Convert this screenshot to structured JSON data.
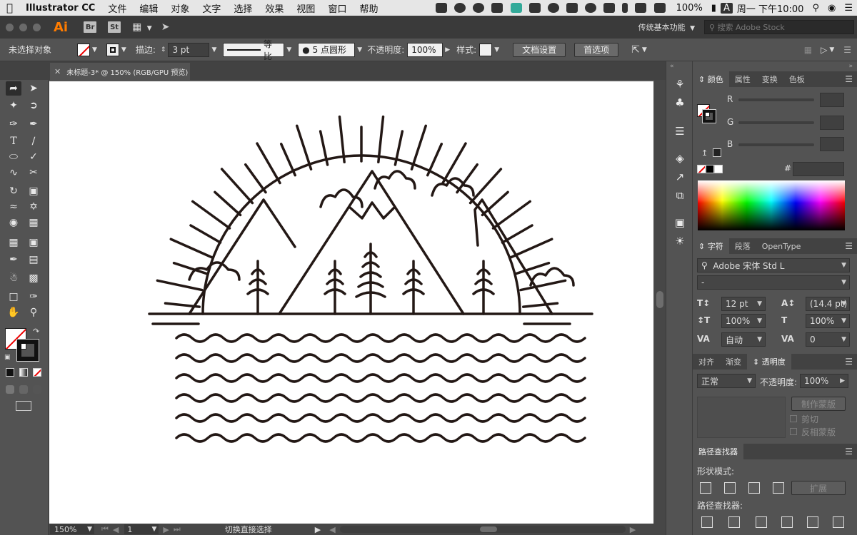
{
  "menubar": {
    "app": "Illustrator CC",
    "items": [
      "文件",
      "编辑",
      "对象",
      "文字",
      "选择",
      "效果",
      "视图",
      "窗口",
      "帮助"
    ],
    "battery": "100%",
    "ime": "A",
    "clock": "周一 下午10:00"
  },
  "appbar": {
    "logo": "Ai",
    "bridge": "Br",
    "stock": "St",
    "workspace": "传统基本功能",
    "search_placeholder": "搜索 Adobe Stock"
  },
  "control": {
    "selection": "未选择对象",
    "stroke_label": "描边:",
    "stroke_value": "3 pt",
    "profile": "等比",
    "brush": "5 点圆形",
    "opacity_label": "不透明度:",
    "opacity_value": "100%",
    "style_label": "样式:",
    "doc_setup": "文档设置",
    "preferences": "首选项"
  },
  "document": {
    "tab_title": "未标题-3* @ 150% (RGB/GPU 预览)"
  },
  "status": {
    "zoom": "150%",
    "artboard": "1",
    "tool_hint": "切换直接选择"
  },
  "color_panel": {
    "tabs": [
      "颜色",
      "属性",
      "变换",
      "色板"
    ],
    "r": "R",
    "g": "G",
    "b": "B",
    "hash": "#"
  },
  "char_panel": {
    "tabs": [
      "字符",
      "段落",
      "OpenType"
    ],
    "font": "Adobe 宋体 Std L",
    "style": "-",
    "size": "12 pt",
    "leading": "(14.4 pt)",
    "vscale": "100%",
    "hscale": "100%",
    "kerning": "自动",
    "tracking": "0"
  },
  "transparency_panel": {
    "tabs": [
      "对齐",
      "渐变",
      "透明度"
    ],
    "mode": "正常",
    "opacity_label": "不透明度:",
    "opacity_value": "100%",
    "make_mask": "制作蒙版",
    "clip": "剪切",
    "invert": "反相蒙版"
  },
  "pathfinder_panel": {
    "tab": "路径查找器",
    "shape_modes": "形状模式:",
    "expand": "扩展",
    "pathfinders": "路径查找器:"
  },
  "colors": {
    "chrome": "#535353",
    "ink": "#231815"
  }
}
